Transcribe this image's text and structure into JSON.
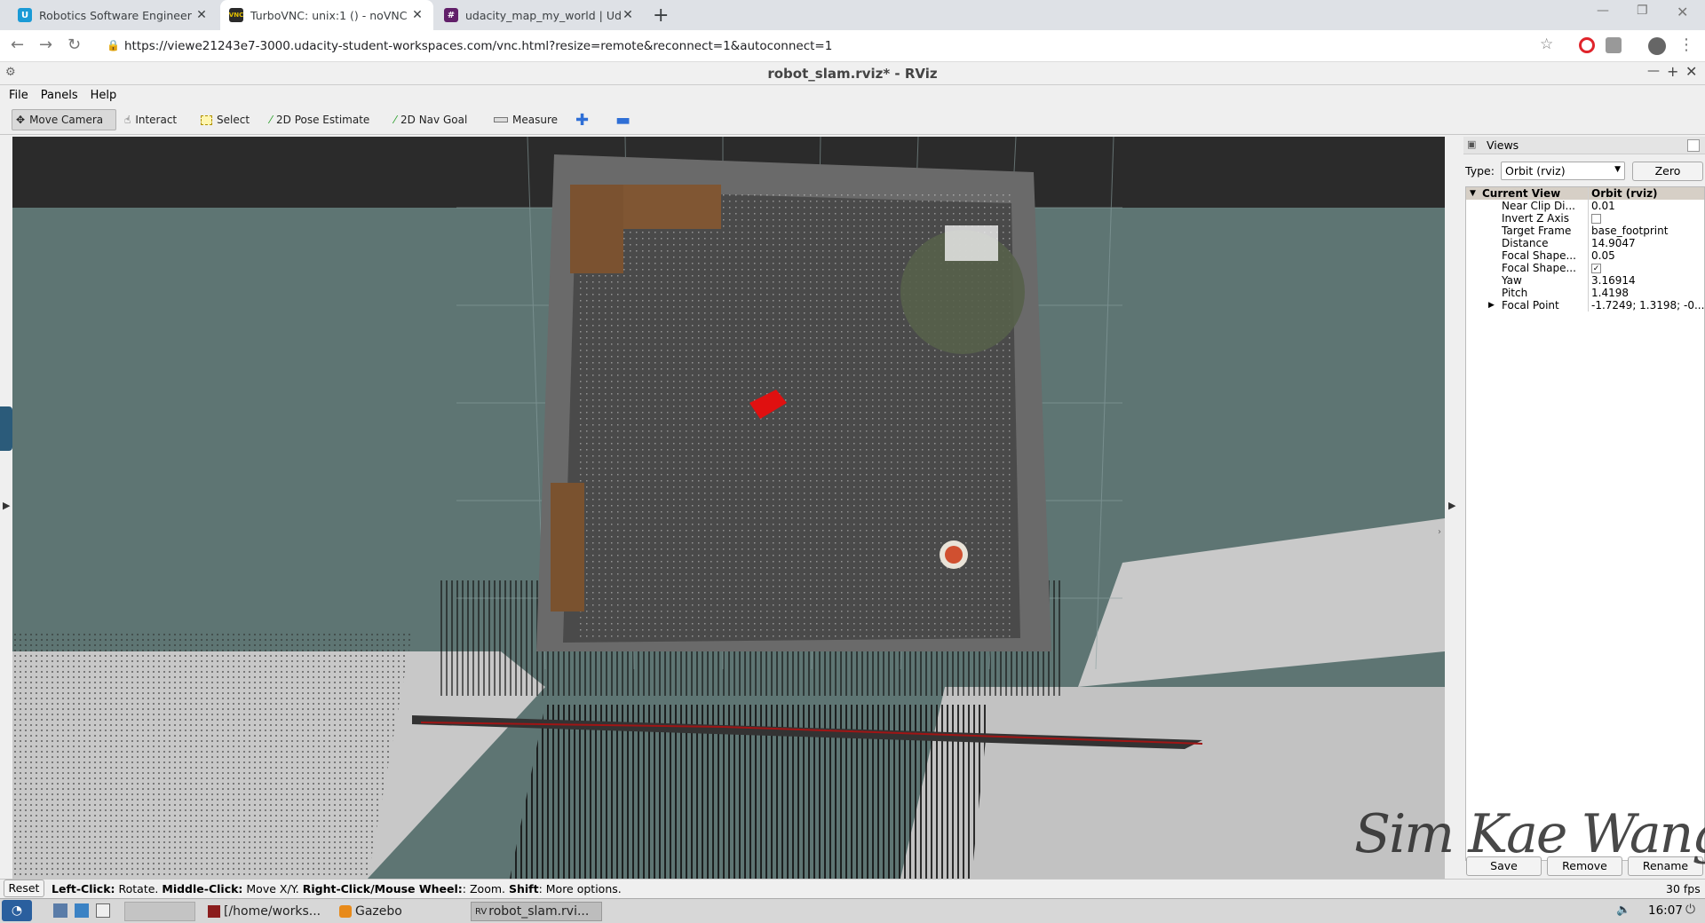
{
  "browser": {
    "tabs": [
      {
        "label": "Robotics Software Engineer - Uda"
      },
      {
        "label": "TurboVNC: unix:1 () - noVNC"
      },
      {
        "label": "udacity_map_my_world | Udacity"
      }
    ],
    "url": "https://viewe21243e7-3000.udacity-student-workspaces.com/vnc.html?resize=remote&reconnect=1&autoconnect=1"
  },
  "rviz": {
    "window_title": "robot_slam.rviz* - RViz",
    "menu": [
      "File",
      "Panels",
      "Help"
    ],
    "tools": [
      "Move Camera",
      "Interact",
      "Select",
      "2D Pose Estimate",
      "2D Nav Goal",
      "Measure"
    ],
    "views_panel": {
      "title": "Views",
      "type_label": "Type:",
      "type_value": "Orbit (rviz)",
      "zero_label": "Zero",
      "current_view": {
        "key": "Current View",
        "value": "Orbit (rviz)"
      },
      "properties": [
        {
          "key": "Near Clip Di...",
          "value": "0.01"
        },
        {
          "key": "Invert Z Axis",
          "value": ""
        },
        {
          "key": "Target Frame",
          "value": "base_footprint"
        },
        {
          "key": "Distance",
          "value": "14.9047"
        },
        {
          "key": "Focal Shape...",
          "value": "0.05"
        },
        {
          "key": "Focal Shape...",
          "value": "✓"
        },
        {
          "key": "Yaw",
          "value": "3.16914"
        },
        {
          "key": "Pitch",
          "value": "1.4198"
        },
        {
          "key": "Focal Point",
          "value": "-1.7249; 1.3198; -0..."
        }
      ],
      "save_label": "Save",
      "remove_label": "Remove",
      "rename_label": "Rename"
    },
    "status": {
      "reset_label": "Reset",
      "hint_left_bold": "Left-Click:",
      "hint_left": " Rotate. ",
      "hint_mid_bold": "Middle-Click:",
      "hint_mid": " Move X/Y. ",
      "hint_right_bold": "Right-Click/Mouse Wheel:",
      "hint_right": ": Zoom. ",
      "hint_shift_bold": "Shift",
      "hint_shift": ": More options.",
      "fps": "30 fps"
    }
  },
  "taskbar": {
    "items": [
      "[/home/works...",
      "Gazebo",
      "robot_slam.rvi..."
    ],
    "clock": "16:07"
  },
  "watermark": "Sim Kae Wang"
}
